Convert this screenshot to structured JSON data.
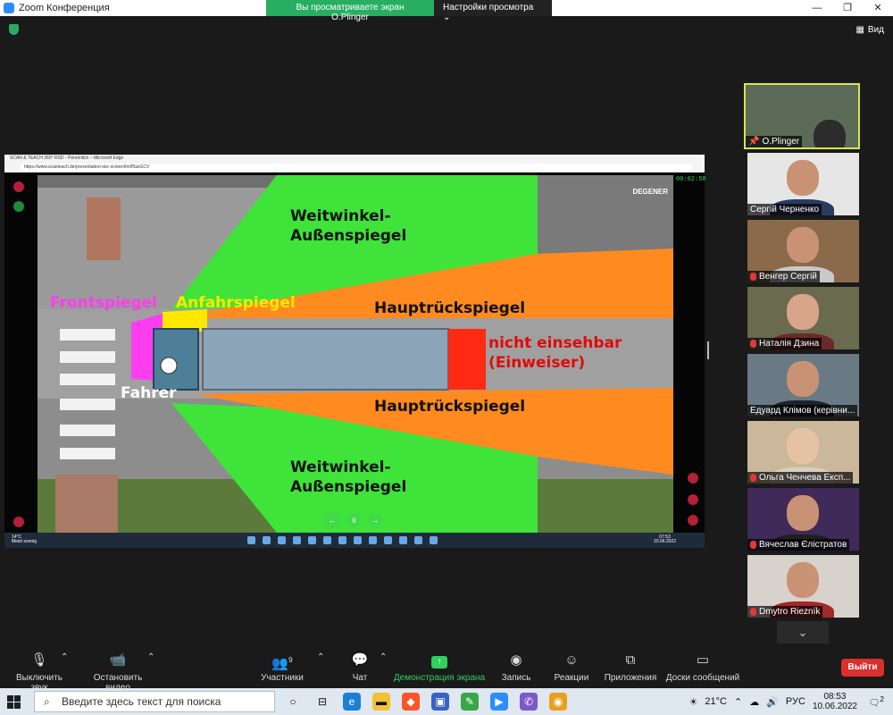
{
  "window": {
    "title": "Zoom Конференция"
  },
  "banner": {
    "viewing": "Вы просматриваете экран O.Plinger",
    "settings": "Настройки просмотра"
  },
  "top_right": {
    "view_label": "Вид"
  },
  "shared_screen": {
    "browser_tab": "SCAN & TEACH 360° RSD - Persönlich – Microsoft Edge",
    "url": "https://www.scanteach.de/presentation-sec-screen/Im/f5axGCV",
    "timer": "00:02:58",
    "brand": "DEGENER",
    "labels": {
      "weitwinkel_top": "Weitwinkel-\nAußenspiegel",
      "frontspiegel": "Frontspiegel",
      "anfahrspiegel": "Anfahrspiegel",
      "hauptrueck_top": "Hauptrückspiegel",
      "nicht_einsehbar": "nicht einsehbar\n(Einweiser)",
      "fahrer": "Fahrer",
      "hauptrueck_bottom": "Hauptrückspiegel",
      "weitwinkel_bottom": "Weitwinkel-\nAußenspiegel"
    },
    "inner_taskbar": {
      "weather_temp": "14°C",
      "weather_desc": "Meist sonnig",
      "time": "07:53",
      "date": "10.06.2022"
    }
  },
  "participants": [
    {
      "name": "O.Plinger",
      "active": true,
      "muted": false
    },
    {
      "name": "Сергій Черненко",
      "muted": false
    },
    {
      "name": "Венгер Сергій",
      "muted": true
    },
    {
      "name": "Наталія Дзина",
      "muted": true
    },
    {
      "name": "Едуард Клімов (керівни...",
      "muted": false
    },
    {
      "name": "Ольга Ченчева Експ...",
      "muted": true
    },
    {
      "name": "Вячеслав Єлістратов",
      "muted": true
    },
    {
      "name": "Dmytro Riezník",
      "muted": true
    }
  ],
  "toolbar": {
    "mute": "Выключить звук",
    "video": "Остановить видео",
    "participants": "Участники",
    "participants_count": "9",
    "chat": "Чат",
    "share": "Демонстрация экрана",
    "record": "Запись",
    "reactions": "Реакции",
    "apps": "Приложения",
    "whiteboard": "Доски сообщений",
    "leave": "Выйти"
  },
  "taskbar": {
    "search_placeholder": "Введите здесь текст для поиска",
    "temperature": "21°C",
    "language": "РУС",
    "time": "08:53",
    "date": "10.06.2022",
    "notifications": "2"
  },
  "colors": {
    "green_zone": "#3fe33a",
    "orange_zone": "#ff8a1f",
    "red_zone": "#ff2a14",
    "pink_zone": "#ff3df0",
    "yellow_zone": "#ffe800",
    "leave": "#d9302c"
  }
}
